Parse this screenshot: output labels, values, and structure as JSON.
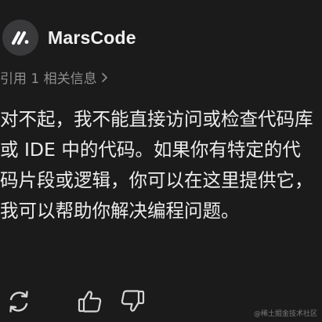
{
  "app": {
    "name": "MarsCode",
    "icon": "marscode-logo-icon"
  },
  "references": {
    "label": "引用 1 相关信息",
    "icon": "chevron-right-icon"
  },
  "message": {
    "text": "对不起，我不能直接访问或检查代码库或 IDE 中的代码。如果你有特定的代码片段或逻辑，你可以在这里提供它，我可以帮助你解决编程问题。"
  },
  "actions": [
    {
      "name": "regenerate",
      "icon": "refresh-icon"
    },
    {
      "name": "like",
      "icon": "thumbs-up-icon"
    },
    {
      "name": "dislike",
      "icon": "thumbs-down-icon"
    }
  ],
  "watermark": "@稀土掘金技术社区",
  "colors": {
    "background": "#1b1b1b",
    "text": "#ececec",
    "muted": "#8f8f8f",
    "logo_bg": "#3a3a3d"
  }
}
